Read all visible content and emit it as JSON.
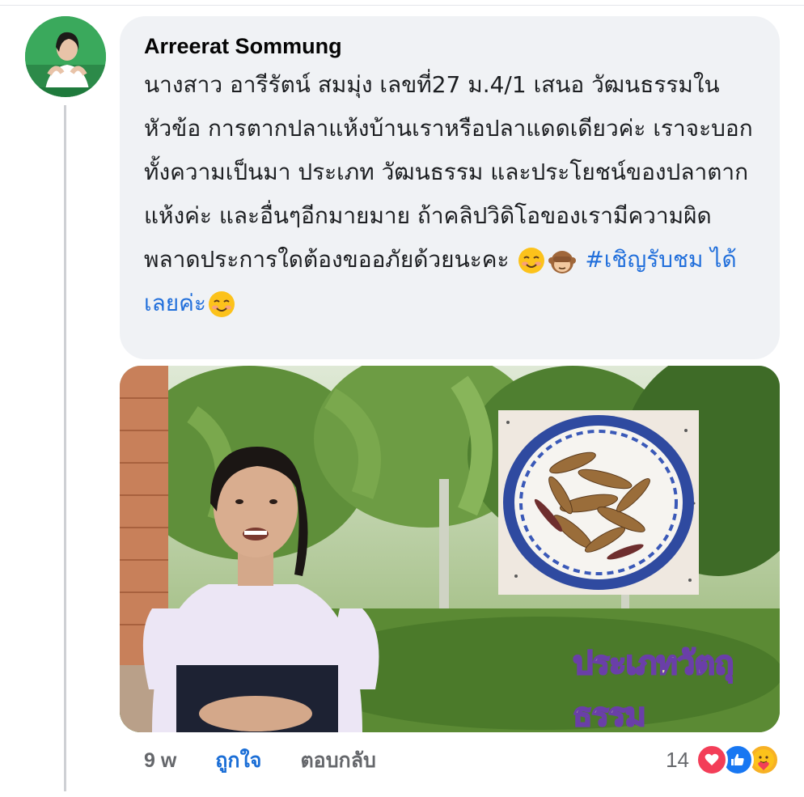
{
  "comment": {
    "author": "Arreerat Sommung",
    "text_main": "นางสาว อารีรัตน์ สมมุ่ง เลขที่27 ม.4/1 เสนอ วัฒนธรรมในหัวข้อ การตากปลาแห้งบ้านเราหรือปลาแดดเดียวค่ะ เราจะบอกทั้งความเป็นมา ประเภท วัฒนธรรม และประโยชน์ของปลาตากแห้งค่ะ และอื่นๆอีกมายมาย ถ้าคลิปวิดิโอของเรามีความผิดพลาดประการใดต้องขออภัยด้วยนะคะ",
    "hashtag_part1": "#เชิญรับชม",
    "hashtag_part2": "ได้เลยค่ะ",
    "emoji_names": [
      "smiling-face-icon",
      "see-no-evil-monkey-icon",
      "smiling-face-icon"
    ]
  },
  "media": {
    "overlay_caption": "ประเภทวัตถุธรรม"
  },
  "footer": {
    "time": "9 w",
    "like_label": "ถูกใจ",
    "reply_label": "ตอบกลับ"
  },
  "reactions": {
    "count": "14",
    "icons": [
      "love-reaction-icon",
      "like-reaction-icon",
      "care-reaction-icon"
    ]
  },
  "colors": {
    "bubble": "#f0f2f5",
    "link": "#216fdb",
    "meta": "#65676b",
    "like_blue": "#1877f2",
    "love_red": "#f33e58"
  }
}
